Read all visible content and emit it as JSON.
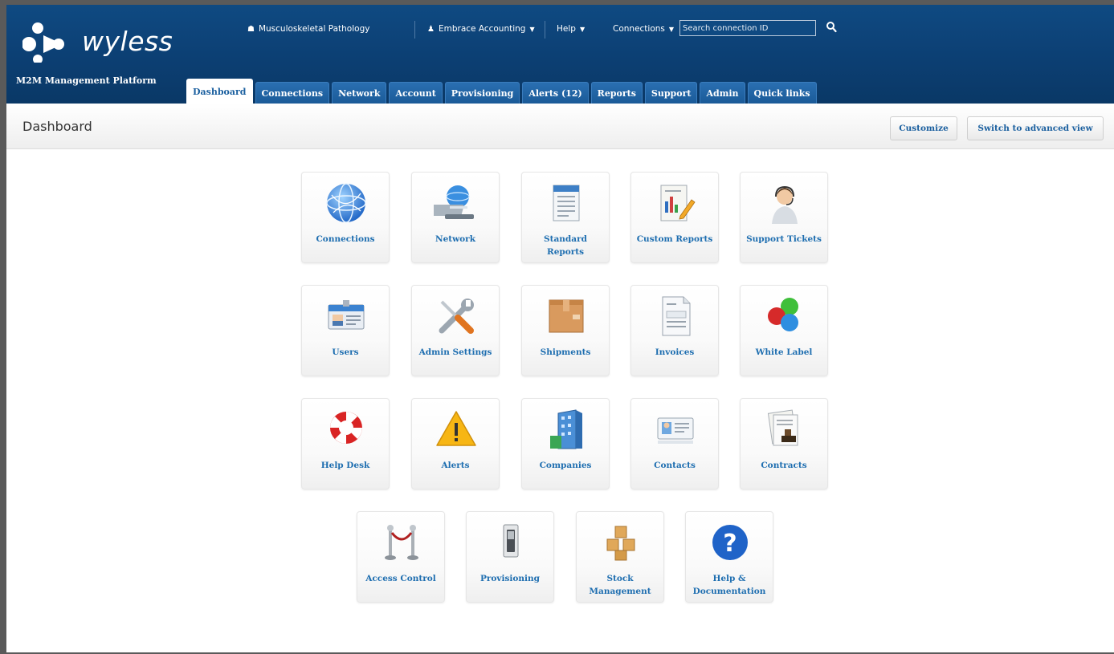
{
  "brand": {
    "logo_text": "wyless",
    "platform": "M2M Management Platform"
  },
  "utility": {
    "account": "Musculoskeletal Pathology",
    "user": "Embrace Accounting",
    "help": "Help",
    "connections": "Connections",
    "search_placeholder": "Search connection ID"
  },
  "tabs": [
    {
      "label": "Dashboard"
    },
    {
      "label": "Connections"
    },
    {
      "label": "Network"
    },
    {
      "label": "Account"
    },
    {
      "label": "Provisioning"
    },
    {
      "label": "Alerts (12)"
    },
    {
      "label": "Reports"
    },
    {
      "label": "Support"
    },
    {
      "label": "Admin"
    },
    {
      "label": "Quick links"
    }
  ],
  "page": {
    "title": "Dashboard",
    "customize": "Customize",
    "advanced": "Switch to advanced view"
  },
  "tiles": [
    {
      "label": "Connections",
      "icon": "globe-icon"
    },
    {
      "label": "Network",
      "icon": "network-icon"
    },
    {
      "label": "Standard Reports",
      "icon": "standard-report-icon"
    },
    {
      "label": "Custom Reports",
      "icon": "custom-report-icon"
    },
    {
      "label": "Support Tickets",
      "icon": "support-agent-icon"
    },
    {
      "label": "Users",
      "icon": "id-badge-icon"
    },
    {
      "label": "Admin Settings",
      "icon": "wrench-screwdriver-icon"
    },
    {
      "label": "Shipments",
      "icon": "package-icon"
    },
    {
      "label": "Invoices",
      "icon": "invoice-icon"
    },
    {
      "label": "White Label",
      "icon": "color-balls-icon"
    },
    {
      "label": "Help Desk",
      "icon": "lifebuoy-icon"
    },
    {
      "label": "Alerts",
      "icon": "warning-icon"
    },
    {
      "label": "Companies",
      "icon": "building-icon"
    },
    {
      "label": "Contacts",
      "icon": "contact-card-icon"
    },
    {
      "label": "Contracts",
      "icon": "contract-stamp-icon"
    },
    {
      "label": "Access Control",
      "icon": "rope-barrier-icon"
    },
    {
      "label": "Provisioning",
      "icon": "switch-icon"
    },
    {
      "label": "Stock Management",
      "icon": "boxes-icon"
    },
    {
      "label": "Help & Documentation",
      "icon": "help-question-icon"
    }
  ]
}
